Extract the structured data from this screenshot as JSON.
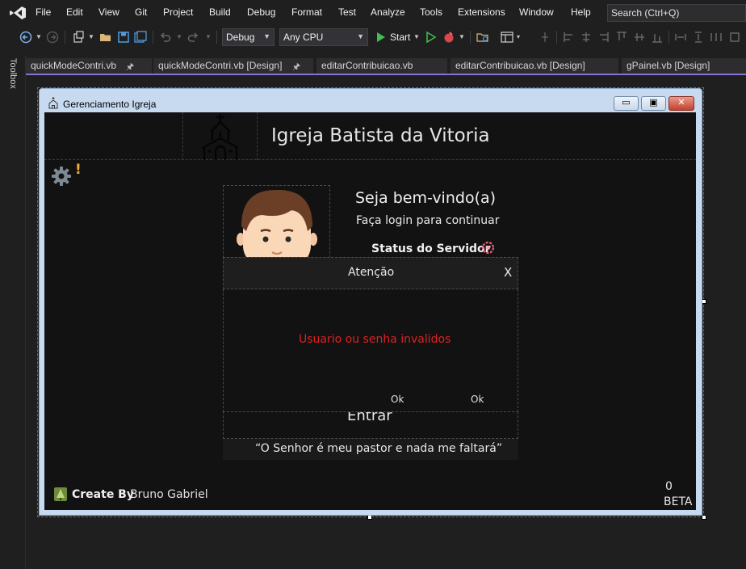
{
  "menu": {
    "items": [
      "File",
      "Edit",
      "View",
      "Git",
      "Project",
      "Build",
      "Debug",
      "Format",
      "Test",
      "Analyze",
      "Tools",
      "Extensions",
      "Window",
      "Help"
    ],
    "search_placeholder": "Search (Ctrl+Q)"
  },
  "toolbar": {
    "configuration": "Debug",
    "platform": "Any CPU",
    "start_label": "Start"
  },
  "toolbox": {
    "label": "Toolbox"
  },
  "tabs": [
    {
      "label": "quickModeContri.vb",
      "pinned": true
    },
    {
      "label": "quickModeContri.vb [Design]",
      "pinned": true
    },
    {
      "label": "editarContribuicao.vb",
      "pinned": false
    },
    {
      "label": "editarContribuicao.vb [Design]",
      "pinned": false
    },
    {
      "label": "gPainel.vb [Design]",
      "pinned": false
    }
  ],
  "form": {
    "title": "Gerenciamento Igreja",
    "church_name": "Igreja Batista da Vitoria",
    "warning_mark": "!",
    "login": {
      "welcome": "Seja bem-vindo(a)",
      "subtitle": "Faça login para continuar",
      "server_status_label": "Status do Servidor",
      "enter_button": "Entrar"
    },
    "dialog": {
      "title": "Atenção",
      "close": "X",
      "message": "Usuario ou senha invalidos",
      "ok_buttons": [
        "Ok",
        "Ok"
      ]
    },
    "quote": "“O Senhor é meu pastor e nada me faltará”",
    "credit": {
      "label": "Create By",
      "name": "Bruno Gabriel"
    },
    "counter": "0",
    "version_tag": "BETA"
  },
  "colors": {
    "accent_tab_line": "#8a6fd6",
    "error_text": "#e02020",
    "warning_mark": "#f0b030",
    "client_background": "#121212"
  }
}
